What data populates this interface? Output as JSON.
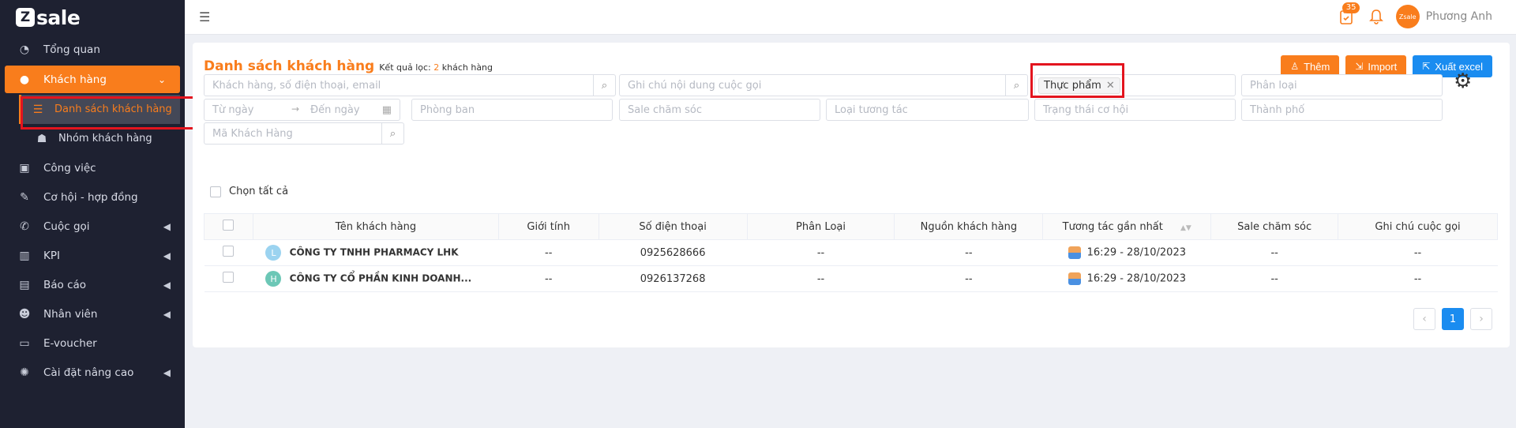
{
  "brand": {
    "logo_letter": "Z",
    "logo_text": "sale"
  },
  "sidebar": {
    "items": [
      {
        "label": "Tổng quan",
        "icon": "dashboard-icon"
      },
      {
        "label": "Khách hàng",
        "icon": "user-icon"
      },
      {
        "label": "Danh sách khách hàng",
        "icon": "list-icon"
      },
      {
        "label": "Nhóm khách hàng",
        "icon": "group-icon"
      },
      {
        "label": "Công việc",
        "icon": "briefcase-icon"
      },
      {
        "label": "Cơ hội - hợp đồng",
        "icon": "contract-icon"
      },
      {
        "label": "Cuộc gọi",
        "icon": "phone-icon"
      },
      {
        "label": "KPI",
        "icon": "chart-icon"
      },
      {
        "label": "Báo cáo",
        "icon": "report-icon"
      },
      {
        "label": "Nhân viên",
        "icon": "staff-icon"
      },
      {
        "label": "E-voucher",
        "icon": "voucher-icon"
      },
      {
        "label": "Cài đặt nâng cao",
        "icon": "settings-icon"
      }
    ]
  },
  "topbar": {
    "notification_count": "35",
    "user_name": "Phương Anh",
    "avatar_text": "Zsale"
  },
  "page": {
    "title": "Danh sách khách hàng",
    "filter_prefix": "Kết quả lọc:",
    "filter_count": "2",
    "filter_suffix": "khách hàng",
    "buttons": {
      "add": "Thêm",
      "import": "Import",
      "export": "Xuất excel"
    }
  },
  "filters": {
    "search_placeholder": "Khách hàng, số điện thoại, email",
    "note_placeholder": "Ghi chú nội dung cuộc gọi",
    "tag_value": "Thực phẩm",
    "category_placeholder": "Phân loại",
    "from_date": "Từ ngày",
    "to_date": "Đến ngày",
    "department": "Phòng ban",
    "sale": "Sale chăm sóc",
    "interaction_type": "Loại tương tác",
    "opportunity_status": "Trạng thái cơ hội",
    "city": "Thành phố",
    "customer_code": "Mã Khách Hàng",
    "select_all": "Chọn tất cả"
  },
  "table": {
    "columns": [
      "Tên khách hàng",
      "Giới tính",
      "Số điện thoại",
      "Phân Loại",
      "Nguồn khách hàng",
      "Tương tác gần nhất",
      "Sale chăm sóc",
      "Ghi chú cuộc gọi"
    ],
    "rows": [
      {
        "initial": "L",
        "initial_color": "#9bd3f0",
        "name": "CÔNG TY TNHH PHARMACY LHK",
        "gender": "--",
        "phone": "0925628666",
        "category": "--",
        "source": "--",
        "last_interaction": "16:29 - 28/10/2023",
        "sale": "--",
        "note": "--"
      },
      {
        "initial": "H",
        "initial_color": "#6cc7b6",
        "name": "CÔNG TY CỔ PHẦN KINH DOANH...",
        "gender": "--",
        "phone": "0926137268",
        "category": "--",
        "source": "--",
        "last_interaction": "16:29 - 28/10/2023",
        "sale": "--",
        "note": "--"
      }
    ]
  },
  "pagination": {
    "current": "1",
    "prev": "‹",
    "next": "›"
  }
}
